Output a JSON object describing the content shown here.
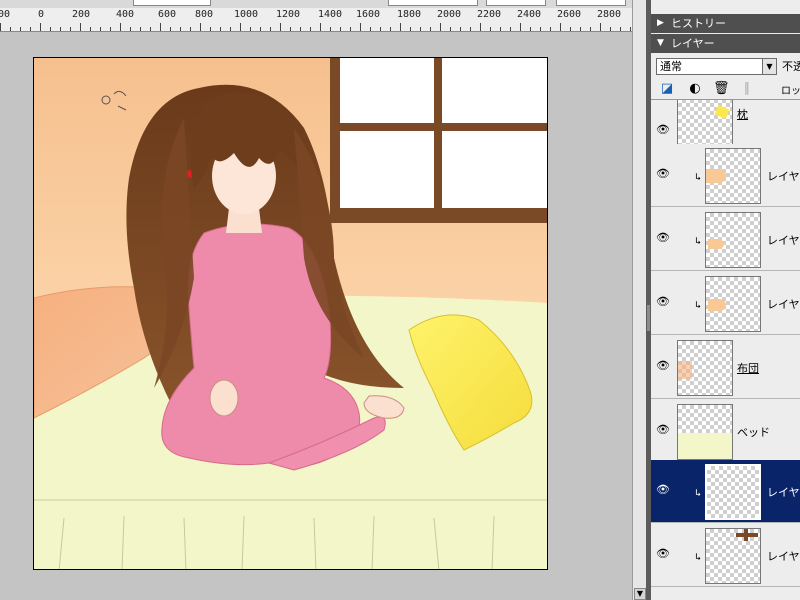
{
  "options_bar": {
    "field1": "",
    "field2": "",
    "field3": "",
    "field4": ""
  },
  "ruler": {
    "labels": [
      "200",
      "0",
      "200",
      "400",
      "600",
      "800",
      "1000",
      "1200",
      "1400",
      "1600",
      "1800",
      "2000",
      "2200",
      "2400",
      "2600",
      "2800"
    ]
  },
  "panel": {
    "history_title": "ヒストリー",
    "layers_title": "レイヤー",
    "blend_mode": "通常",
    "opacity_label": "不透",
    "lock_label": "ロック:"
  },
  "layers": [
    {
      "name": "枕",
      "visible": true,
      "clipped": false,
      "selected": false,
      "underlined": true
    },
    {
      "name": "レイヤー",
      "visible": true,
      "clipped": true,
      "selected": false,
      "underlined": false
    },
    {
      "name": "レイヤー",
      "visible": true,
      "clipped": true,
      "selected": false,
      "underlined": false
    },
    {
      "name": "レイヤー",
      "visible": true,
      "clipped": true,
      "selected": false,
      "underlined": false
    },
    {
      "name": "布団",
      "visible": true,
      "clipped": false,
      "selected": false,
      "underlined": true
    },
    {
      "name": "ベッド",
      "visible": true,
      "clipped": false,
      "selected": false,
      "underlined": false
    },
    {
      "name": "レイヤー",
      "visible": true,
      "clipped": true,
      "selected": true,
      "underlined": false
    },
    {
      "name": "レイヤー",
      "visible": true,
      "clipped": true,
      "selected": false,
      "underlined": false
    }
  ],
  "colors": {
    "panel_header": "#4f4f4f",
    "selection": "#0a246a",
    "wall": "#f9c995",
    "bed": "#f2f6c8",
    "pajamas": "#ee8aaa",
    "hair": "#6b3c1c",
    "pillow": "#fbe84a"
  },
  "icons": {
    "visibility": "eye-icon",
    "clipping": "clipping-arrow-icon",
    "collapse": "triangle-icon"
  }
}
